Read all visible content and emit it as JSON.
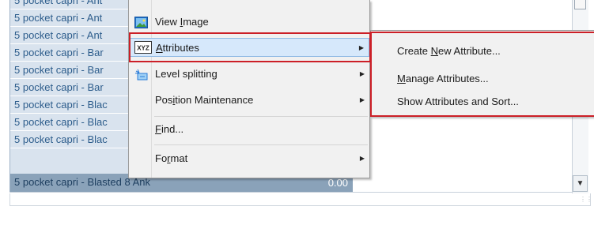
{
  "list": {
    "rows": [
      "5 pocket capri - Ant",
      "5 pocket capri - Ant",
      "5 pocket capri - Ant",
      "5 pocket capri - Bar",
      "5 pocket capri - Bar",
      "5 pocket capri - Bar",
      "5 pocket capri - Blac",
      "5 pocket capri - Blac",
      "5 pocket capri - Blac"
    ],
    "selected_row": "5 pocket capri - Blasted 8 Ank",
    "selected_value": "0.00"
  },
  "context_menu": {
    "items": [
      {
        "pre": "View ",
        "u": "I",
        "post": "mage",
        "icon": "image-icon",
        "submenu": false
      },
      {
        "pre": "",
        "u": "A",
        "post": "ttributes",
        "icon": "xyz-attributes-icon",
        "submenu": true
      },
      {
        "pre": "Level splitting",
        "u": "",
        "post": "",
        "icon": "level-split-icon",
        "submenu": true
      },
      {
        "pre": "Pos",
        "u": "i",
        "post": "tion Maintenance",
        "icon": "",
        "submenu": true
      },
      {
        "pre": "",
        "u": "F",
        "post": "ind...",
        "icon": "",
        "submenu": false
      },
      {
        "pre": "Fo",
        "u": "r",
        "post": "mat",
        "icon": "",
        "submenu": true
      }
    ]
  },
  "submenu": {
    "items": [
      {
        "pre": "Create ",
        "u": "N",
        "post": "ew Attribute..."
      },
      {
        "pre": "",
        "u": "M",
        "post": "anage Attributes..."
      },
      {
        "pre": "Show Attributes and Sort...",
        "u": "",
        "post": ""
      }
    ]
  },
  "highlight_color": "#cc1f27",
  "selection_color": "#8aa2b9"
}
